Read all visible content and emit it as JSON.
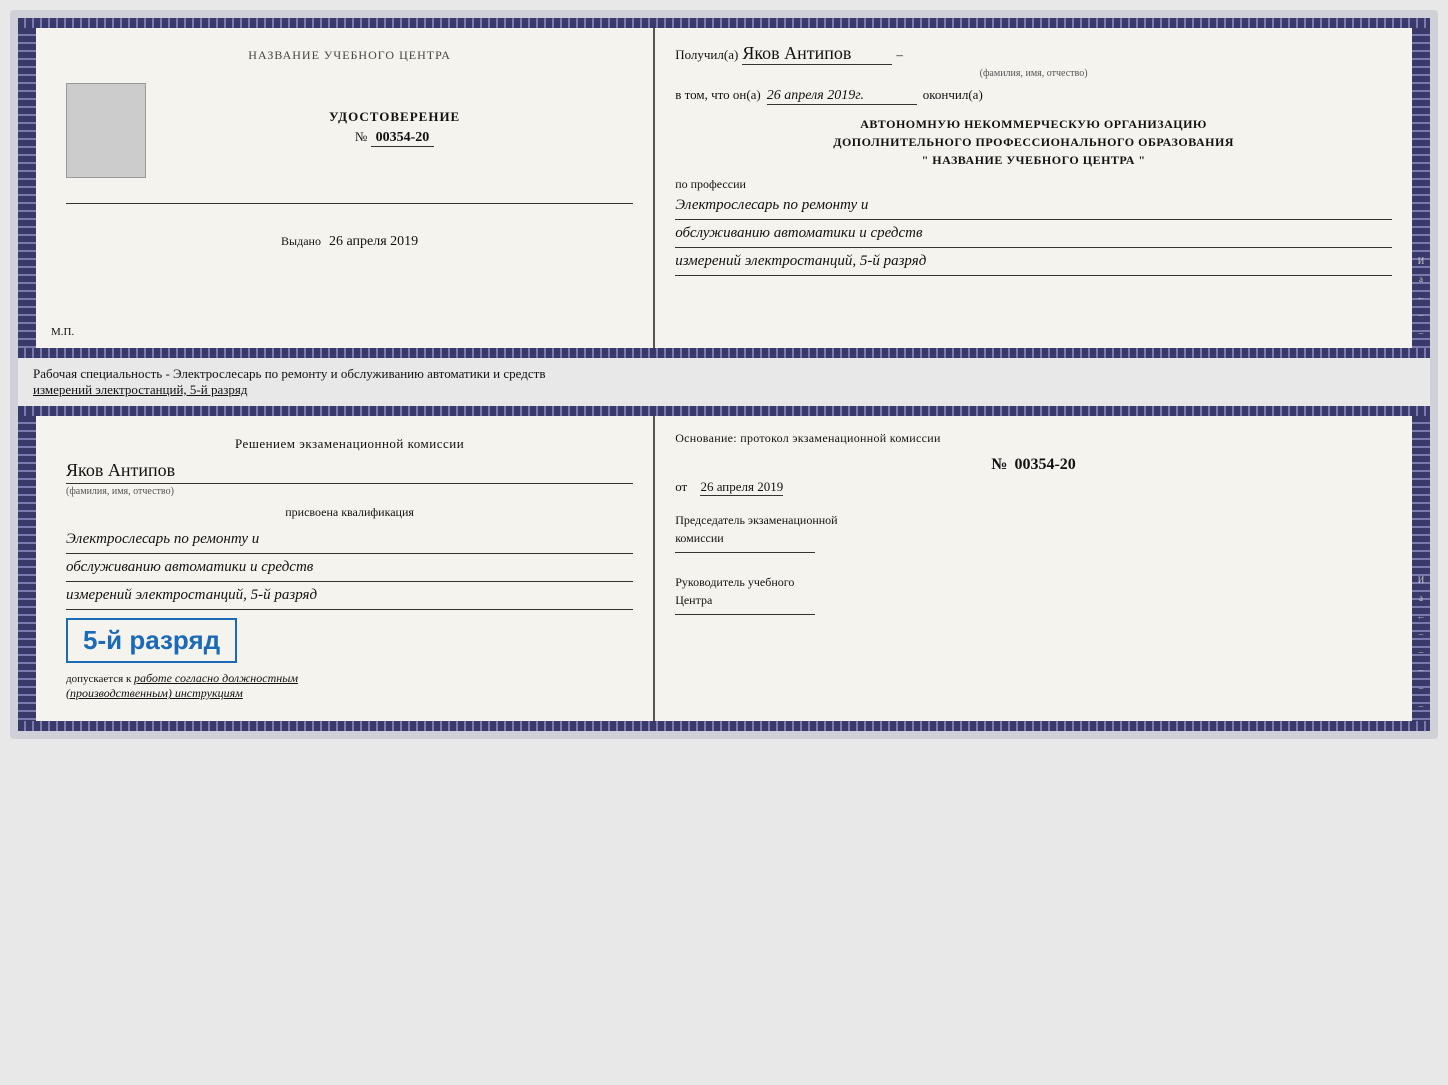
{
  "doc1": {
    "left": {
      "center_title": "НАЗВАНИЕ УЧЕБНОГО ЦЕНТРА",
      "photo_alt": "фото",
      "udostoverenie_title": "УДОСТОВЕРЕНИЕ",
      "number_prefix": "№",
      "number": "00354-20",
      "vydano_label": "Выдано",
      "vydano_date": "26 апреля 2019",
      "mp": "М.П."
    },
    "right": {
      "poluchil_label": "Получил(а)",
      "poluchil_value": "Яков Антипов",
      "fio_label": "(фамилия, имя, отчество)",
      "dash": "–",
      "vtom_label": "в том, что он(а)",
      "vtom_date": "26 апреля 2019г.",
      "okончил": "окончил(а)",
      "ank_line1": "АВТОНОМНУЮ НЕКОММЕРЧЕСКУЮ ОРГАНИЗАЦИЮ",
      "ank_line2": "ДОПОЛНИТЕЛЬНОГО ПРОФЕССИОНАЛЬНОГО ОБРАЗОВАНИЯ",
      "ank_line3_pre": "\"",
      "ank_line3_center": "НАЗВАНИЕ УЧЕБНОГО ЦЕНТРА",
      "ank_line3_post": "\"",
      "po_professii": "по профессии",
      "profession_line1": "Электрослесарь по ремонту и",
      "profession_line2": "обслуживанию автоматики и средств",
      "profession_line3": "измерений электростанций, 5-й разряд",
      "right_chars": [
        "И",
        "а",
        "←",
        "–",
        "–",
        "–",
        "–"
      ]
    }
  },
  "middle": {
    "text_line1": "Рабочая специальность - Электрослесарь по ремонту и обслуживанию автоматики и средств",
    "text_line2": "измерений электростанций, 5-й разряд"
  },
  "doc2": {
    "left": {
      "resheniem_line1": "Решением  экзаменационной  комиссии",
      "fio_value": "Яков Антипов",
      "fio_label": "(фамилия, имя, отчество)",
      "prisvoena": "присвоена квалификация",
      "profession_line1": "Электрослесарь по ремонту и",
      "profession_line2": "обслуживанию автоматики и средств",
      "profession_line3": "измерений электростанций, 5-й разряд",
      "razryad_text": "5-й разряд",
      "dopuskaetsya_label": "допускается к",
      "dopuskaetsya_value": "работе согласно должностным",
      "dopuskaetsya_value2": "(производственным) инструкциям"
    },
    "right": {
      "osnovanie_label": "Основание: протокол экзаменационной  комиссии",
      "number_prefix": "№",
      "protocol_number": "00354-20",
      "ot_label": "от",
      "ot_date": "26 апреля 2019",
      "predsedatel_line1": "Председатель экзаменационной",
      "predsedatel_line2": "комиссии",
      "rukovoditel_line1": "Руководитель учебного",
      "rukovoditel_line2": "Центра",
      "right_chars": [
        "И",
        "а",
        "←",
        "–",
        "–",
        "–",
        "–",
        "–"
      ]
    }
  }
}
